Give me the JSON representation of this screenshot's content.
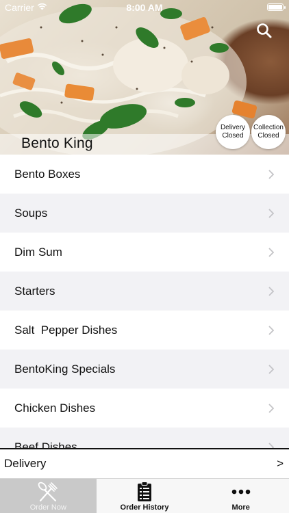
{
  "status_bar": {
    "carrier": "Carrier",
    "time": "8:00 AM"
  },
  "header": {
    "restaurant_name": "Bento King",
    "delivery_status": {
      "line1": "Delivery",
      "line2": "Closed"
    },
    "collection_status": {
      "line1": "Collection",
      "line2": "Closed"
    }
  },
  "categories": [
    {
      "label": "Bento Boxes"
    },
    {
      "label": "Soups"
    },
    {
      "label": "Dim Sum"
    },
    {
      "label": "Starters"
    },
    {
      "label": "Salt  Pepper Dishes"
    },
    {
      "label": "BentoKing Specials"
    },
    {
      "label": "Chicken Dishes"
    },
    {
      "label": "Beef Dishes"
    }
  ],
  "order_type_bar": {
    "label": "Delivery",
    "arrow": ">"
  },
  "tab_bar": {
    "tabs": [
      {
        "label": "Order Now",
        "icon": "fork-knife-icon",
        "active": true
      },
      {
        "label": "Order History",
        "icon": "clipboard-list-icon",
        "active": false
      },
      {
        "label": "More",
        "icon": "ellipsis-icon",
        "active": false
      }
    ]
  },
  "colors": {
    "accent": "#111111",
    "list_alt_row": "#f2f2f5",
    "tab_active_bg": "#c9c9c9"
  }
}
